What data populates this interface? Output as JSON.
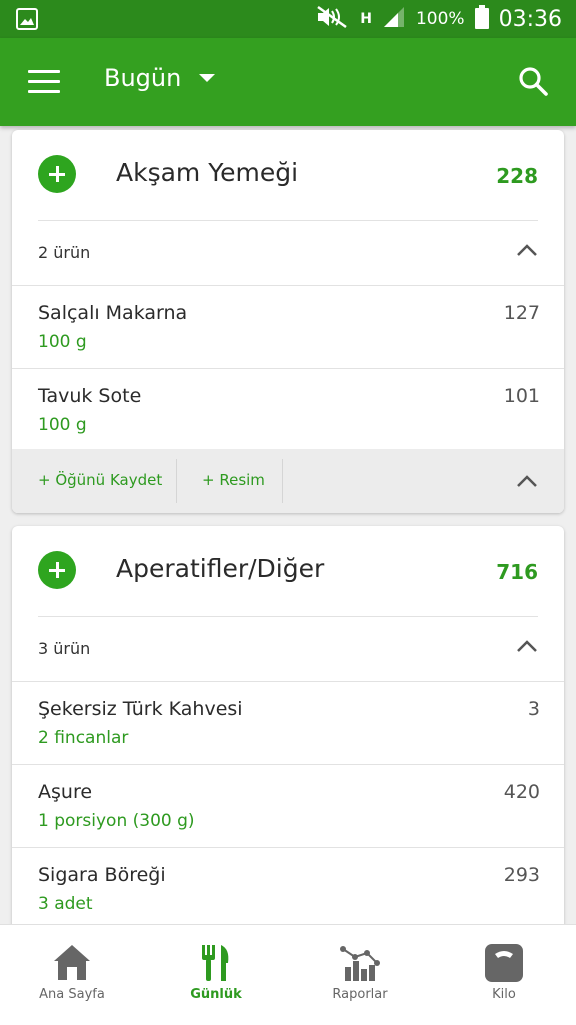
{
  "status_bar": {
    "network_type": "H",
    "battery": "100%",
    "time": "03:36"
  },
  "app_bar": {
    "title": "Bugün",
    "menu_icon": "hamburger-menu-icon",
    "search_icon": "search-icon"
  },
  "meals": [
    {
      "title": "Akşam Yemeği",
      "calories": "228",
      "count": "2 ürün",
      "items": [
        {
          "name": "Salçalı Makarna",
          "amount": "100  g",
          "calories": "127"
        },
        {
          "name": "Tavuk Sote",
          "amount": "100  g",
          "calories": "101"
        }
      ],
      "actions": {
        "save": "+ Öğünü Kaydet",
        "photo": "+ Resim"
      }
    },
    {
      "title": "Aperatifler/Diğer",
      "calories": "716",
      "count": "3 ürün",
      "items": [
        {
          "name": "Şekersiz Türk Kahvesi",
          "amount": "2  fincanlar",
          "calories": "3"
        },
        {
          "name": "Aşure",
          "amount": "1  porsiyon (300 g)",
          "calories": "420"
        },
        {
          "name": "Sigara Böreği",
          "amount": "3  adet",
          "calories": "293"
        }
      ]
    }
  ],
  "bottom_nav": [
    {
      "label": "Ana Sayfa",
      "icon": "home-icon"
    },
    {
      "label": "Günlük",
      "icon": "fork-knife-icon",
      "active": true
    },
    {
      "label": "Raporlar",
      "icon": "chart-icon"
    },
    {
      "label": "Kilo",
      "icon": "scale-icon"
    }
  ],
  "colors": {
    "status_bar": "#2c8a1c",
    "app_bar": "#34a020",
    "accent": "#2e9a20"
  }
}
